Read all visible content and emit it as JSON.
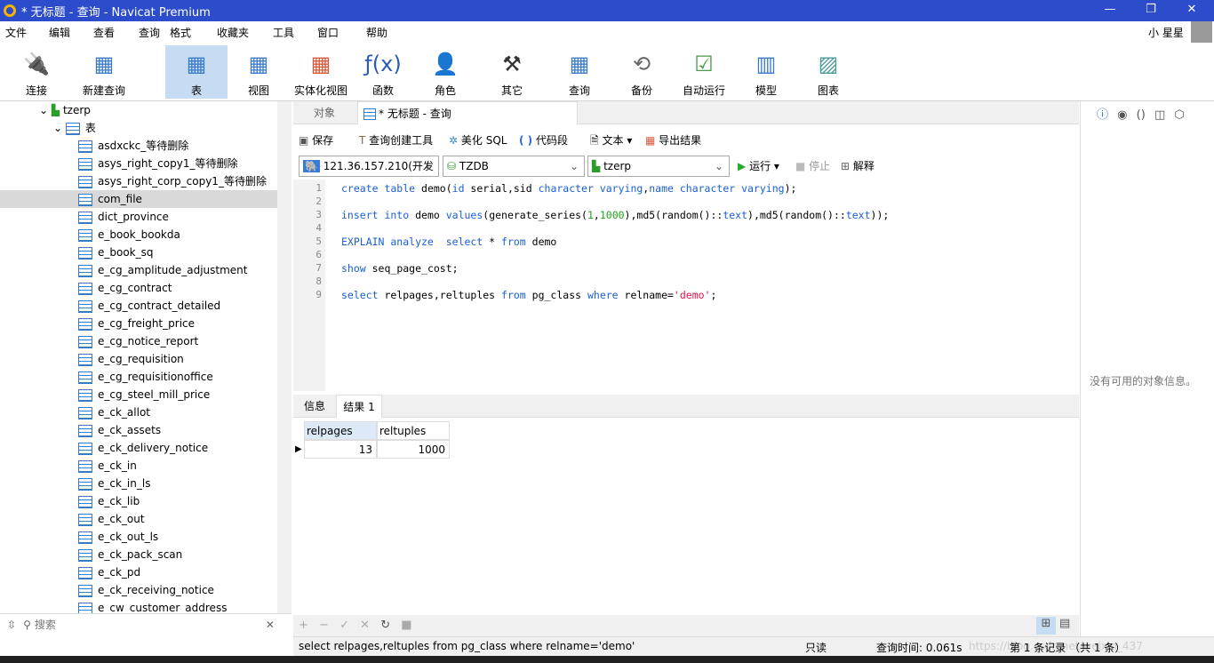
{
  "window": {
    "title": "* 无标题 - 查询 - Navicat Premium",
    "minimize": "—",
    "maximize": "❐",
    "close": "✕"
  },
  "menu": [
    "文件",
    "编辑",
    "查看",
    "查询",
    "格式",
    "收藏夹",
    "工具",
    "窗口",
    "帮助"
  ],
  "user": "小 星星",
  "toolbar": [
    {
      "label": "连接",
      "icon": "plug-icon"
    },
    {
      "label": "新建查询",
      "icon": "new-query-icon"
    },
    {
      "label": "表",
      "icon": "table-icon",
      "active": true
    },
    {
      "label": "视图",
      "icon": "view-icon"
    },
    {
      "label": "实体化视图",
      "icon": "materialized-view-icon"
    },
    {
      "label": "函数",
      "icon": "function-icon"
    },
    {
      "label": "角色",
      "icon": "user-icon"
    },
    {
      "label": "其它",
      "icon": "tools-icon"
    },
    {
      "label": "查询",
      "icon": "query-icon"
    },
    {
      "label": "备份",
      "icon": "backup-icon"
    },
    {
      "label": "自动运行",
      "icon": "schedule-icon"
    },
    {
      "label": "模型",
      "icon": "model-icon"
    },
    {
      "label": "图表",
      "icon": "chart-icon"
    }
  ],
  "sidebar": {
    "schema": "tzerp",
    "group": "表",
    "selected": "com_file",
    "tables": [
      "asdxckc_等待删除",
      "asys_right_copy1_等待删除",
      "asys_right_corp_copy1_等待删除",
      "com_file",
      "dict_province",
      "e_book_bookda",
      "e_book_sq",
      "e_cg_amplitude_adjustment",
      "e_cg_contract",
      "e_cg_contract_detailed",
      "e_cg_freight_price",
      "e_cg_notice_report",
      "e_cg_requisition",
      "e_cg_requisitionoffice",
      "e_cg_steel_mill_price",
      "e_ck_allot",
      "e_ck_assets",
      "e_ck_delivery_notice",
      "e_ck_in",
      "e_ck_in_ls",
      "e_ck_lib",
      "e_ck_out",
      "e_ck_out_ls",
      "e_ck_pack_scan",
      "e_ck_pd",
      "e_ck_receiving_notice",
      "e_cw_customer_address"
    ],
    "search_placeholder": "搜索"
  },
  "tabs": {
    "objects": "对象",
    "query": "* 无标题 - 查询"
  },
  "query_toolbar": {
    "save": "保存",
    "builder": "查询创建工具",
    "beautify": "美化 SQL",
    "snippet": "代码段",
    "text": "文本",
    "export": "导出结果"
  },
  "connection": {
    "server": "121.36.157.210(开发",
    "database": "TZDB",
    "schema": "tzerp",
    "run": "运行",
    "stop": "停止",
    "explain": "解释"
  },
  "editor_lines": [
    "1",
    "2",
    "3",
    "4",
    "5",
    "6",
    "7",
    "8",
    "9"
  ],
  "result_tabs": {
    "info": "信息",
    "result": "结果 1"
  },
  "result_table": {
    "columns": [
      "relpages",
      "reltuples"
    ],
    "rows": [
      [
        "13",
        "1000"
      ]
    ]
  },
  "right_panel": {
    "empty_text": "没有可用的对象信息。"
  },
  "status": {
    "sql": "select relpages,reltuples from pg_class where relname='demo'",
    "readonly": "只读",
    "query_time": "查询时间: 0.061s",
    "record": "第 1 条记录 （共 1 条）",
    "watermark": "https://blog.csdn.net/weixin_437"
  }
}
